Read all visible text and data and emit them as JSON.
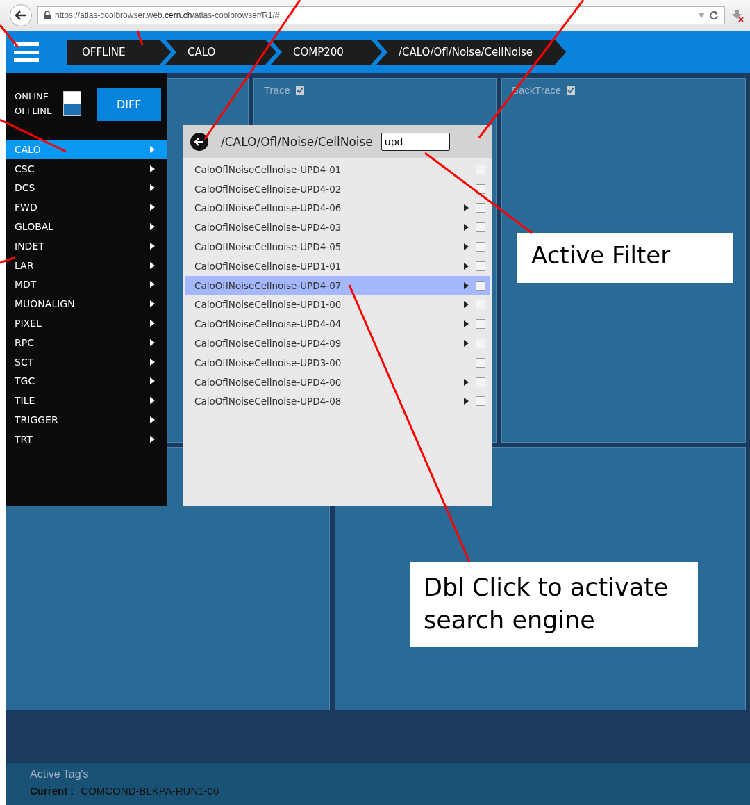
{
  "browser": {
    "url": "https://atlas-coolbrowser.web.**cern.ch**/atlas-coolbrowser/R1/#"
  },
  "breadcrumbs": [
    "OFFLINE",
    "CALO",
    "COMP200",
    "/CALO/Ofl/Noise/CellNoise"
  ],
  "sidebar": {
    "modes": [
      {
        "label": "ONLINE",
        "selected": false
      },
      {
        "label": "OFFLINE",
        "selected": true
      }
    ],
    "diff_button": "DIFF",
    "items": [
      {
        "label": "CALO",
        "selected": true
      },
      {
        "label": "CSC",
        "selected": false
      },
      {
        "label": "DCS",
        "selected": false
      },
      {
        "label": "FWD",
        "selected": false
      },
      {
        "label": "GLOBAL",
        "selected": false
      },
      {
        "label": "INDET",
        "selected": false
      },
      {
        "label": "LAR",
        "selected": false
      },
      {
        "label": "MDT",
        "selected": false
      },
      {
        "label": "MUONALIGN",
        "selected": false
      },
      {
        "label": "PIXEL",
        "selected": false
      },
      {
        "label": "RPC",
        "selected": false
      },
      {
        "label": "SCT",
        "selected": false
      },
      {
        "label": "TGC",
        "selected": false
      },
      {
        "label": "TILE",
        "selected": false
      },
      {
        "label": "TRIGGER",
        "selected": false
      },
      {
        "label": "TRT",
        "selected": false
      }
    ]
  },
  "panels": [
    {
      "title": "Trace",
      "checked": true
    },
    {
      "title": "BackTrace",
      "checked": true
    }
  ],
  "popup": {
    "path": "/CALO/Ofl/Noise/CellNoise",
    "filter": "upd",
    "items": [
      {
        "label": "CaloOflNoiseCellnoise-UPD4-01",
        "has_children": false,
        "checked": false,
        "selected": false
      },
      {
        "label": "CaloOflNoiseCellnoise-UPD4-02",
        "has_children": false,
        "checked": false,
        "selected": false
      },
      {
        "label": "CaloOflNoiseCellnoise-UPD4-06",
        "has_children": true,
        "checked": false,
        "selected": false
      },
      {
        "label": "CaloOflNoiseCellnoise-UPD4-03",
        "has_children": true,
        "checked": false,
        "selected": false
      },
      {
        "label": "CaloOflNoiseCellnoise-UPD4-05",
        "has_children": true,
        "checked": false,
        "selected": false
      },
      {
        "label": "CaloOflNoiseCellnoise-UPD1-01",
        "has_children": true,
        "checked": false,
        "selected": false
      },
      {
        "label": "CaloOflNoiseCellnoise-UPD4-07",
        "has_children": true,
        "checked": false,
        "selected": true
      },
      {
        "label": "CaloOflNoiseCellnoise-UPD1-00",
        "has_children": true,
        "checked": false,
        "selected": false
      },
      {
        "label": "CaloOflNoiseCellnoise-UPD4-04",
        "has_children": true,
        "checked": false,
        "selected": false
      },
      {
        "label": "CaloOflNoiseCellnoise-UPD4-09",
        "has_children": true,
        "checked": false,
        "selected": false
      },
      {
        "label": "CaloOflNoiseCellnoise-UPD3-00",
        "has_children": false,
        "checked": false,
        "selected": false
      },
      {
        "label": "CaloOflNoiseCellnoise-UPD4-00",
        "has_children": true,
        "checked": false,
        "selected": false
      },
      {
        "label": "CaloOflNoiseCellnoise-UPD4-08",
        "has_children": true,
        "checked": false,
        "selected": false
      }
    ]
  },
  "footer": {
    "title": "Active Tag's",
    "current_label": "Current :",
    "current_value": "COMCOND-BLKPA-RUN1-06"
  },
  "annotations": [
    "Active Filter",
    "Dbl Click to activate search engine"
  ]
}
